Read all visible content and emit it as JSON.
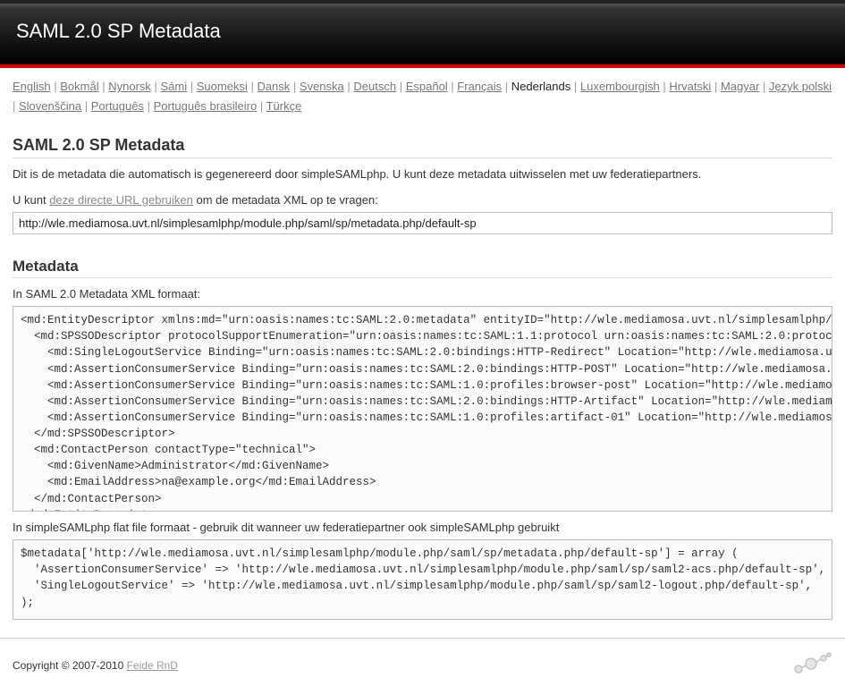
{
  "header": {
    "title": "SAML 2.0 SP Metadata"
  },
  "languages": {
    "items": [
      "English",
      "Bokmål",
      "Nynorsk",
      "Sámi",
      "Suomeksi",
      "Dansk",
      "Svenska",
      "Deutsch",
      "Español",
      "Français",
      "Nederlands",
      "Luxembourgish",
      "Hrvatski",
      "Magyar",
      "Język polski",
      "Slovenščina",
      "Português",
      "Português brasileiro",
      "Türkçe"
    ],
    "current": "Nederlands"
  },
  "page": {
    "title": "SAML 2.0 SP Metadata",
    "intro": "Dit is de metadata die automatisch is gegenereerd door simpleSAMLphp. U kunt deze metadata uitwisselen met uw federatiepartners.",
    "url_sentence_prefix": "U kunt ",
    "url_sentence_link": "deze directe URL gebruiken",
    "url_sentence_suffix": " om de metadata XML op te vragen:",
    "direct_url": "http://wle.mediamosa.uvt.nl/simplesamlphp/module.php/saml/sp/metadata.php/default-sp"
  },
  "metadata": {
    "heading": "Metadata",
    "xml_label": "In SAML 2.0 Metadata XML formaat:",
    "xml": "<md:EntityDescriptor xmlns:md=\"urn:oasis:names:tc:SAML:2.0:metadata\" entityID=\"http://wle.mediamosa.uvt.nl/simplesamlphp/module\n  <md:SPSSODescriptor protocolSupportEnumeration=\"urn:oasis:names:tc:SAML:1.1:protocol urn:oasis:names:tc:SAML:2.0:protocol\">\n    <md:SingleLogoutService Binding=\"urn:oasis:names:tc:SAML:2.0:bindings:HTTP-Redirect\" Location=\"http://wle.mediamosa.uvt.nl/\n    <md:AssertionConsumerService Binding=\"urn:oasis:names:tc:SAML:2.0:bindings:HTTP-POST\" Location=\"http://wle.mediamosa.uvt.nl\n    <md:AssertionConsumerService Binding=\"urn:oasis:names:tc:SAML:1.0:profiles:browser-post\" Location=\"http://wle.mediamosa.uv\n    <md:AssertionConsumerService Binding=\"urn:oasis:names:tc:SAML:2.0:bindings:HTTP-Artifact\" Location=\"http://wle.mediamosa.uv\n    <md:AssertionConsumerService Binding=\"urn:oasis:names:tc:SAML:1.0:profiles:artifact-01\" Location=\"http://wle.mediamosa.uvt\n  </md:SPSSODescriptor>\n  <md:ContactPerson contactType=\"technical\">\n    <md:GivenName>Administrator</md:GivenName>\n    <md:EmailAddress>na@example.org</md:EmailAddress>\n  </md:ContactPerson>\n</md:EntityDescriptor>",
    "flat_label": "In simpleSAMLphp flat file formaat - gebruik dit wanneer uw federatiepartner ook simpleSAMLphp gebruikt",
    "flat": "$metadata['http://wle.mediamosa.uvt.nl/simplesamlphp/module.php/saml/sp/metadata.php/default-sp'] = array (\n  'AssertionConsumerService' => 'http://wle.mediamosa.uvt.nl/simplesamlphp/module.php/saml/sp/saml2-acs.php/default-sp',\n  'SingleLogoutService' => 'http://wle.mediamosa.uvt.nl/simplesamlphp/module.php/saml/sp/saml2-logout.php/default-sp',\n);"
  },
  "footer": {
    "copyright_prefix": "Copyright © 2007-2010 ",
    "copyright_link": "Feide RnD"
  }
}
